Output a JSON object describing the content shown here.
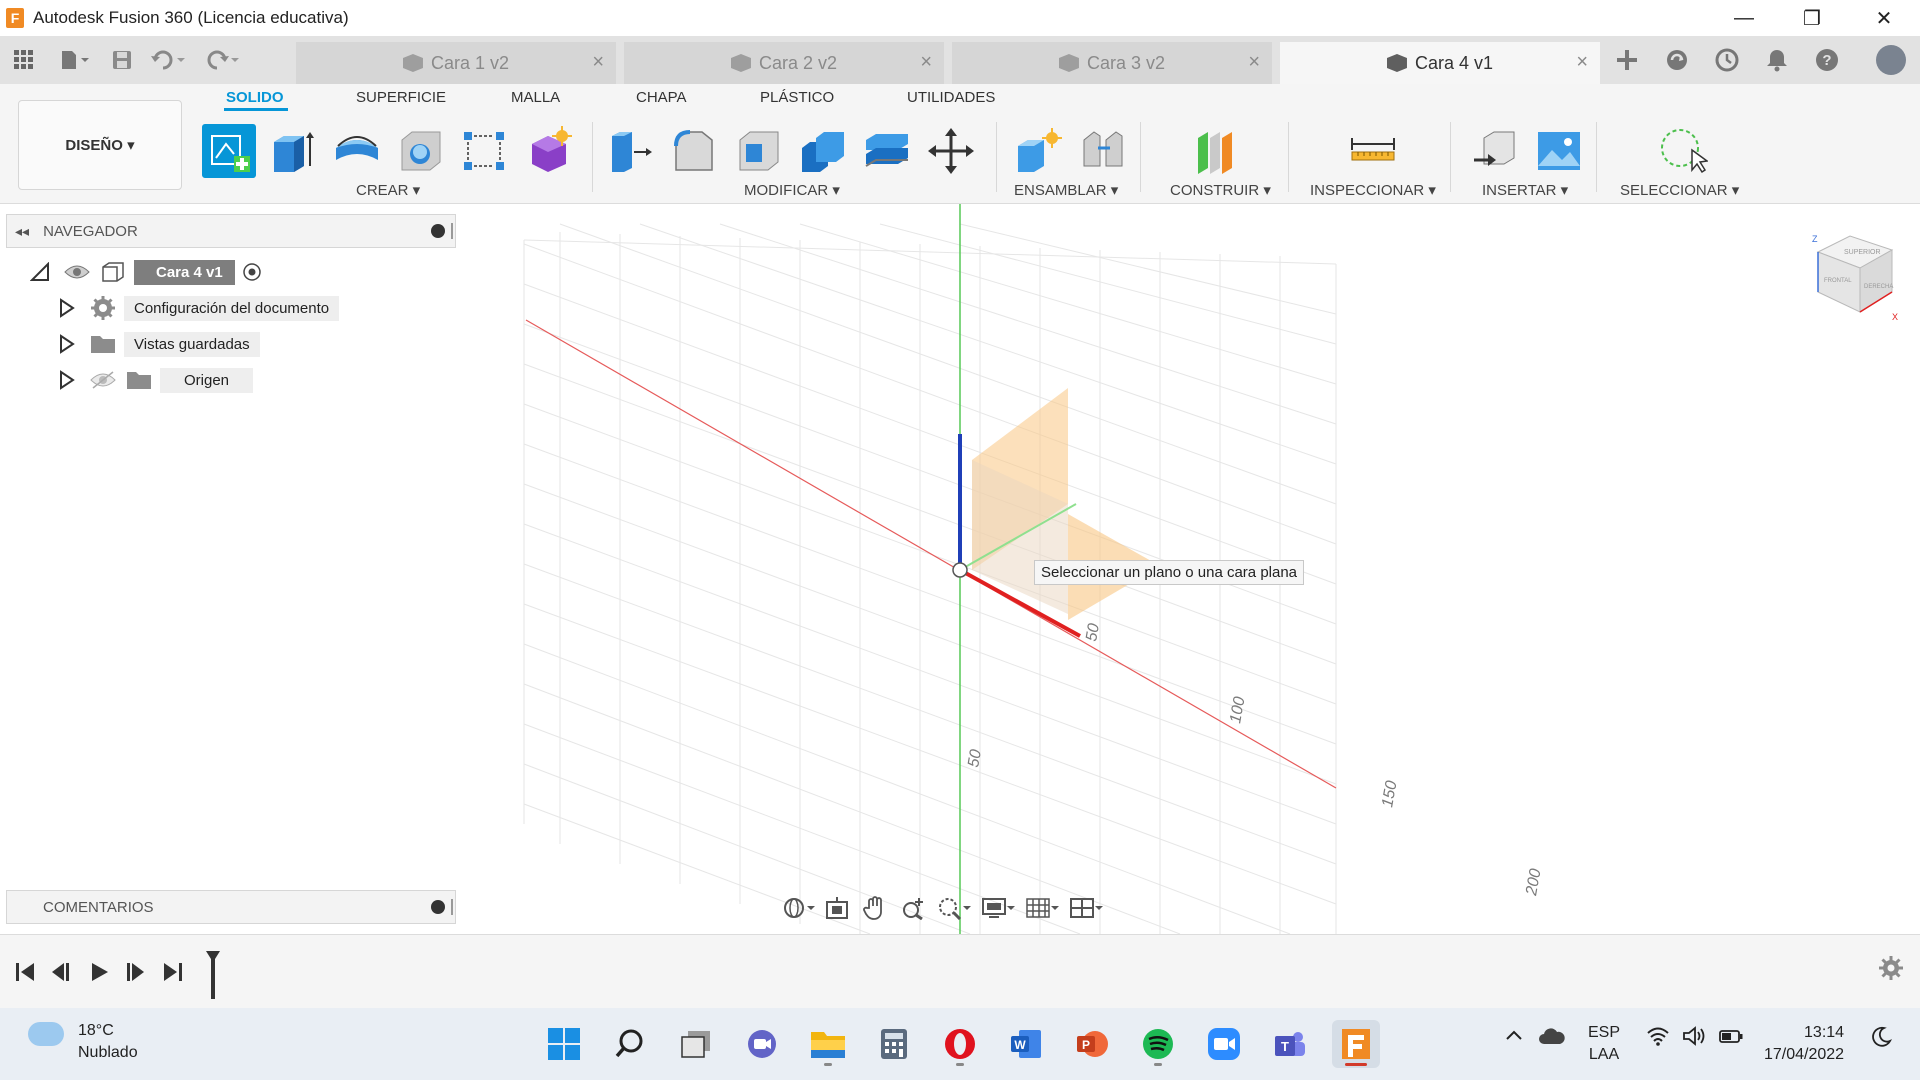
{
  "window": {
    "app_logo": "F",
    "title": "Autodesk Fusion 360 (Licencia educativa)",
    "minimize": "—",
    "restore": "❐",
    "close": "✕"
  },
  "tabs": [
    {
      "label": "Cara 1 v2",
      "active": false
    },
    {
      "label": "Cara 2 v2",
      "active": false
    },
    {
      "label": "Cara 3 v2",
      "active": false
    },
    {
      "label": "Cara 4 v1",
      "active": true
    }
  ],
  "tab_close": "×",
  "ribbon": {
    "workspace": "DISEÑO ▾",
    "tabs": [
      "SOLIDO",
      "SUPERFICIE",
      "MALLA",
      "CHAPA",
      "PLÁSTICO",
      "UTILIDADES"
    ],
    "groups": [
      "CREAR ▾",
      "MODIFICAR ▾",
      "ENSAMBLAR ▾",
      "CONSTRUIR ▾",
      "INSPECCIONAR ▾",
      "INSERTAR ▾",
      "SELECCIONAR ▾"
    ]
  },
  "navigator": {
    "title": "NAVEGADOR",
    "collapse": "◂◂",
    "root": "Cara 4 v1",
    "items": [
      "Configuración del documento",
      "Vistas guardadas",
      "Origen"
    ]
  },
  "comments": {
    "title": "COMENTARIOS"
  },
  "tooltip": "Seleccionar un plano o una cara plana",
  "axis_labels": {
    "x": [
      "50",
      "100",
      "150",
      "200"
    ],
    "y": [
      "50"
    ]
  },
  "viewcube": {
    "top": "SUPERIOR",
    "front": "FRONTAL",
    "right": "DERECHA",
    "z": "Z",
    "x": "X"
  },
  "taskbar": {
    "temperature": "18°C",
    "weather": "Nublado",
    "lang_1": "ESP",
    "lang_2": "LAA",
    "time": "13:14",
    "date": "17/04/2022"
  },
  "colors": {
    "accent": "#0696d7",
    "x_axis": "#e02020",
    "y_axis": "#2fb52f",
    "z_axis": "#1f3fb8",
    "plane": "#f9c784"
  }
}
